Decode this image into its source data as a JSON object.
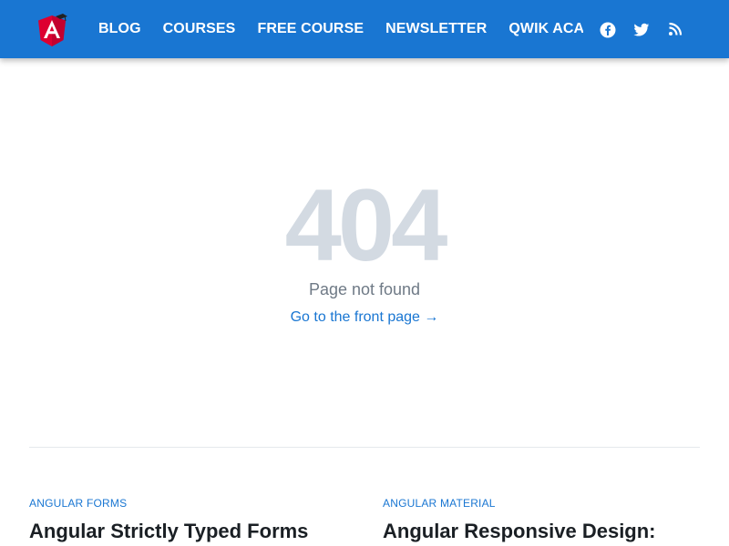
{
  "header": {
    "logo_alt": "Angular University",
    "nav": [
      "BLOG",
      "COURSES",
      "FREE COURSE",
      "NEWSLETTER",
      "QWIK ACADEMY"
    ],
    "social_icons": [
      "facebook-icon",
      "twitter-icon",
      "rss-icon"
    ],
    "brand_color": "#1976d2"
  },
  "error": {
    "code": "404",
    "message": "Page not found",
    "link": "Go to the front page →"
  },
  "posts": [
    {
      "category": "ANGULAR FORMS",
      "title": "Angular Strictly Typed Forms (Complete Guide)"
    },
    {
      "category": "ANGULAR MATERIAL",
      "title": "Angular Responsive Design: Complete Guide"
    }
  ]
}
